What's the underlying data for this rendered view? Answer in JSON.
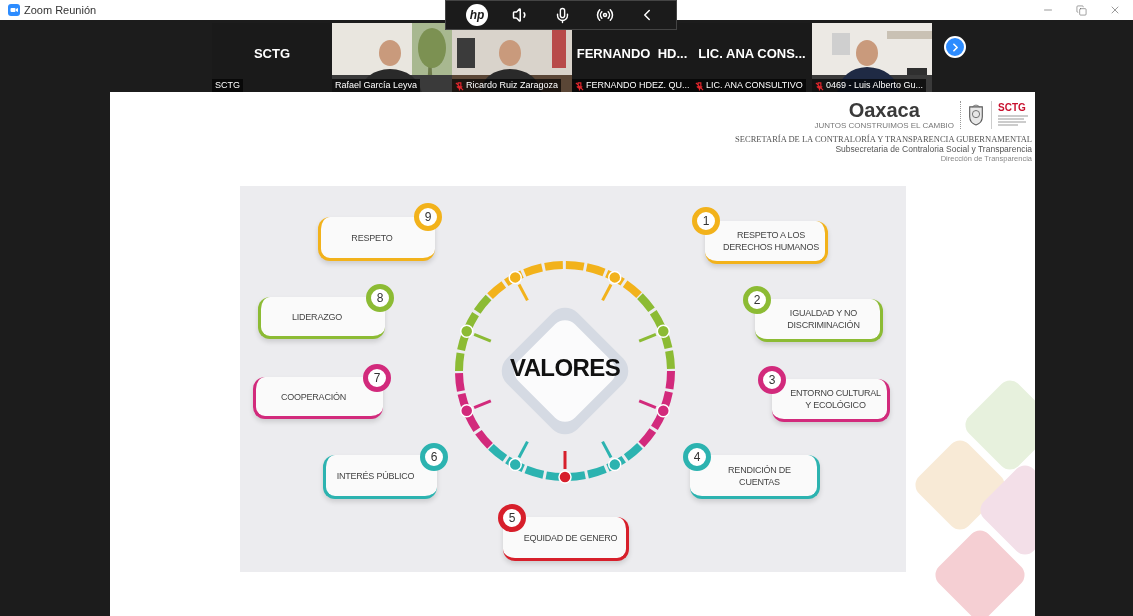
{
  "window": {
    "title": "Zoom Reunión"
  },
  "toolbar": {
    "logo": "hp"
  },
  "participants": [
    {
      "kind": "name",
      "display": "SCTG",
      "name": "SCTG",
      "muted": false
    },
    {
      "kind": "video",
      "name": "Rafael García Leyva",
      "muted": false
    },
    {
      "kind": "video",
      "name": "Ricardo Ruiz Zaragoza",
      "muted": true
    },
    {
      "kind": "name",
      "display": "FERNANDO  HD...",
      "name": "FERNANDO HDEZ. QU...",
      "muted": true
    },
    {
      "kind": "name",
      "display": "LIC. ANA CONS...",
      "name": "LIC. ANA CONSULTIVO",
      "muted": true
    },
    {
      "kind": "video",
      "name": "0469 - Luis Alberto Gu...",
      "muted": true
    }
  ],
  "slide": {
    "logo": {
      "wordmark": "Oaxaca",
      "tagline": "JUNTOS CONSTRUIMOS EL CAMBIO",
      "badge": "SCTG"
    },
    "header": [
      "SECRETARÍA DE LA CONTRALORÍA Y TRANSPARENCIA GUBERNAMENTAL",
      "Subsecretaria de Contraloria Social y Transparencia",
      "Dirección de Transparencia"
    ],
    "diagram": {
      "title": "VALORES",
      "items": [
        {
          "number": "9",
          "label": "RESPETO",
          "color": "#f2b21b"
        },
        {
          "number": "1",
          "label": "RESPETO A LOS\nDERECHOS HUMANOS",
          "color": "#f2b21b"
        },
        {
          "number": "8",
          "label": "LIDERAZGO",
          "color": "#8cbb34"
        },
        {
          "number": "2",
          "label": "IGUALDAD Y NO\nDISCRIMINACIÓN",
          "color": "#8cbb34"
        },
        {
          "number": "7",
          "label": "COOPERACIÓN",
          "color": "#d22a7c"
        },
        {
          "number": "3",
          "label": "ENTORNO CULTURAL\nY ECOLÓGICO",
          "color": "#d22a7c"
        },
        {
          "number": "6",
          "label": "INTERÉS PÚBLICO",
          "color": "#2cb3b0"
        },
        {
          "number": "4",
          "label": "RENDICIÓN DE\nCUENTAS",
          "color": "#2cb3b0"
        },
        {
          "number": "5",
          "label": "EQUIDAD DE GENERO",
          "color": "#d71f2b"
        }
      ]
    }
  }
}
